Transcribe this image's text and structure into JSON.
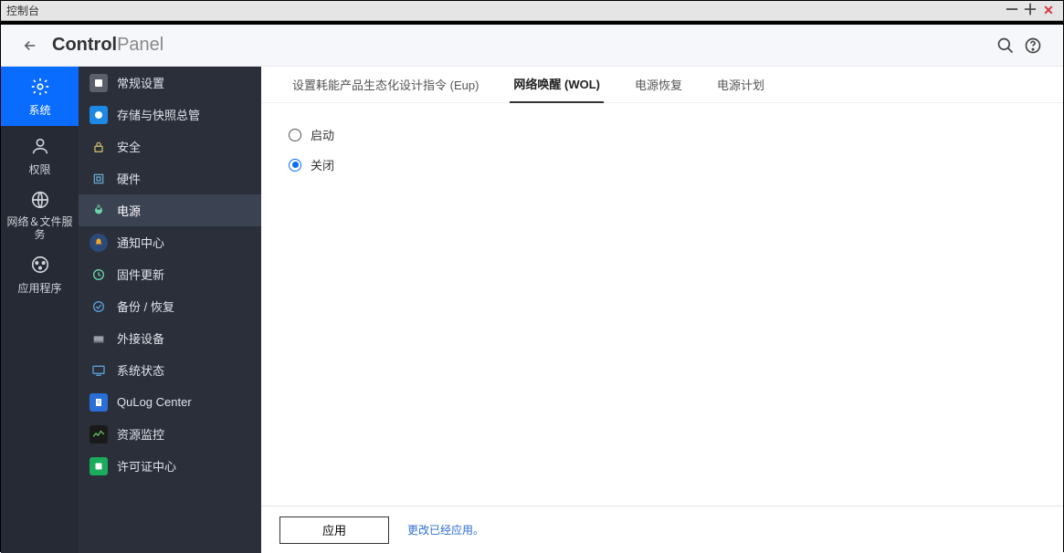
{
  "window": {
    "title": "控制台"
  },
  "header": {
    "title_bold": "Control",
    "title_light": "Panel"
  },
  "rail": {
    "items": [
      {
        "label": "系统"
      },
      {
        "label": "权限"
      },
      {
        "label": "网络＆文件服务"
      },
      {
        "label": "应用程序"
      }
    ]
  },
  "sidebar": {
    "items": [
      {
        "label": "常规设置"
      },
      {
        "label": "存储与快照总管"
      },
      {
        "label": "安全"
      },
      {
        "label": "硬件"
      },
      {
        "label": "电源"
      },
      {
        "label": "通知中心"
      },
      {
        "label": "固件更新"
      },
      {
        "label": "备份 / 恢复"
      },
      {
        "label": "外接设备"
      },
      {
        "label": "系统状态"
      },
      {
        "label": "QuLog Center"
      },
      {
        "label": "资源监控"
      },
      {
        "label": "许可证中心"
      }
    ]
  },
  "tabs": {
    "items": [
      {
        "label": "设置耗能产品生态化设计指令 (Eup)"
      },
      {
        "label": "网络唤醒 (WOL)"
      },
      {
        "label": "电源恢复"
      },
      {
        "label": "电源计划"
      }
    ]
  },
  "options": {
    "enable": "启动",
    "disable": "关闭"
  },
  "footer": {
    "apply": "应用",
    "message": "更改已经应用。"
  }
}
